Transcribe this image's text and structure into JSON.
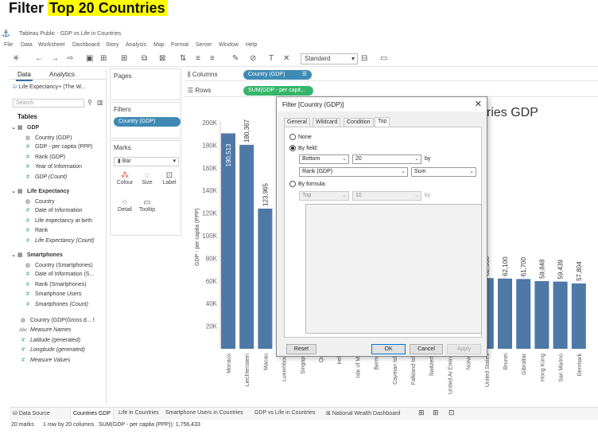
{
  "heading": {
    "prefix": "Filter ",
    "highlight": "Top 20 Countries"
  },
  "window": {
    "title": "Tableau Public - GDP vs Life in Countries"
  },
  "menu": [
    "File",
    "Data",
    "Worksheet",
    "Dashboard",
    "Story",
    "Analysis",
    "Map",
    "Format",
    "Server",
    "Window",
    "Help"
  ],
  "toolbar": {
    "fit_value": "Standard"
  },
  "left_pane": {
    "tabs": [
      "Data",
      "Analytics"
    ],
    "datasource": "Life Expectancy+ (The W...",
    "search_placeholder": "Search",
    "tables_label": "Tables",
    "tables": [
      {
        "name": "GDP",
        "fields": [
          {
            "name": "Country (GDP)",
            "kind": "geo"
          },
          {
            "name": "GDP - per capita (PPP)",
            "kind": "measure"
          },
          {
            "name": "Rank (GDP)",
            "kind": "measure"
          },
          {
            "name": "Year of Information",
            "kind": "measure"
          },
          {
            "name": "GDP (Count)",
            "kind": "measure",
            "italic": true
          }
        ]
      },
      {
        "name": "Life Expectancy",
        "fields": [
          {
            "name": "Country",
            "kind": "geo"
          },
          {
            "name": "Date of Information",
            "kind": "measure"
          },
          {
            "name": "Life expectancy at birth",
            "kind": "measure"
          },
          {
            "name": "Rank",
            "kind": "measure"
          },
          {
            "name": "Life Expectancy (Count)",
            "kind": "measure",
            "italic": true
          }
        ]
      },
      {
        "name": "Smartphones",
        "fields": [
          {
            "name": "Country (Smartphones)",
            "kind": "geo"
          },
          {
            "name": "Date of Information (S...",
            "kind": "measure"
          },
          {
            "name": "Rank (Smartphones)",
            "kind": "measure"
          },
          {
            "name": "Smartphone Users",
            "kind": "measure"
          },
          {
            "name": "Smartphones (Count)",
            "kind": "measure",
            "italic": true
          }
        ]
      }
    ],
    "extra_fields": [
      {
        "name": "Country (GDP(Gross d...",
        "kind": "geo",
        "italic": false
      },
      {
        "name": "Measure Names",
        "kind": "abc",
        "italic": true
      },
      {
        "name": "Latitude (generated)",
        "kind": "measure",
        "italic": true
      },
      {
        "name": "Longitude (generated)",
        "kind": "measure",
        "italic": true
      },
      {
        "name": "Measure Values",
        "kind": "measure",
        "italic": true
      }
    ]
  },
  "cards": {
    "pages_label": "Pages",
    "filters_label": "Filters",
    "filter_pill": "Country (GDP)",
    "marks_label": "Marks",
    "mark_type": "Bar",
    "mark_buttons": [
      "Colour",
      "Size",
      "Label",
      "Detail",
      "Tooltip"
    ]
  },
  "shelves": {
    "columns_label": "Columns",
    "columns_pill": "Country (GDP)",
    "rows_label": "Rows",
    "rows_pill": "SUM(GDP - per capit..."
  },
  "chart_title_fragment": "ries GDP",
  "chart_data": {
    "type": "bar",
    "ylabel": "GDP - per capita (PPP)",
    "ylim": [
      0,
      200000
    ],
    "yticks": [
      "20K",
      "40K",
      "60K",
      "80K",
      "100K",
      "120K",
      "140K",
      "160K",
      "180K",
      "200K"
    ],
    "ytick_values": [
      20000,
      40000,
      60000,
      80000,
      100000,
      120000,
      140000,
      160000,
      180000,
      200000
    ],
    "categories": [
      "Monaco",
      "Liechtenstein",
      "Macau",
      "Luxembourg",
      "Singapore",
      "Qatar",
      "Ireland",
      "Isle of Man",
      "Bermuda",
      "Cayman Islands",
      "Falkland Islands",
      "Switzerland",
      "United Arab Emirates",
      "Norway",
      "United States",
      "Brunei",
      "Gibraltar",
      "Hong Kong",
      "San Marino",
      "Denmark"
    ],
    "visible_categories": [
      "Monaco",
      "Liechtenstein",
      "Macau",
      "Luxembour",
      "Singapo",
      "Qat",
      "Irela",
      "Isle of Ma",
      "Bermu",
      "Cayman Isla",
      "Falkland Isla",
      "Switzerla",
      "United Ar Emirat",
      "Norwa",
      "United States",
      "Brunei",
      "Gibraltar",
      "Hong Kong",
      "San Marino",
      "Denmark"
    ],
    "values": [
      190513,
      180367,
      123965,
      null,
      null,
      null,
      null,
      null,
      null,
      null,
      null,
      null,
      null,
      null,
      62530,
      62100,
      61700,
      59848,
      59439,
      57804
    ],
    "labels": [
      "190,513",
      "180,367",
      "123,965",
      "",
      "",
      "",
      "",
      "",
      "",
      "",
      "",
      "",
      "",
      "",
      "62,530",
      "62,100",
      "61,700",
      "59,848",
      "59,439",
      "57,804"
    ],
    "bar_color": "#4e79a7",
    "grid": false
  },
  "dialog": {
    "title": "Filter [Country (GDP)]",
    "tabs": [
      "General",
      "Wildcard",
      "Condition",
      "Top"
    ],
    "active_tab": "Top",
    "opt_none": "None",
    "opt_by_field": "By field:",
    "by_field": {
      "direction": "Bottom",
      "count": "20",
      "by": "by",
      "field": "Rank (GDP)",
      "agg": "Sum"
    },
    "opt_by_formula": "By formula:",
    "by_formula": {
      "direction": "Top",
      "count": "10",
      "by": "by"
    },
    "buttons": {
      "reset": "Reset",
      "ok": "OK",
      "cancel": "Cancel",
      "apply": "Apply"
    }
  },
  "sheet_tabs": [
    "Data Source",
    "Countries GDP",
    "Life in Countries",
    "Smartphone Users in Countries",
    "GDP vs Life in Countries",
    "National Wealth Dashboard"
  ],
  "active_sheet": "Countries GDP",
  "status": {
    "marks": "20 marks",
    "rows": "1 row by 20 columns",
    "sum": "SUM(GDP - per capita (PPP)): 1,756,433"
  }
}
